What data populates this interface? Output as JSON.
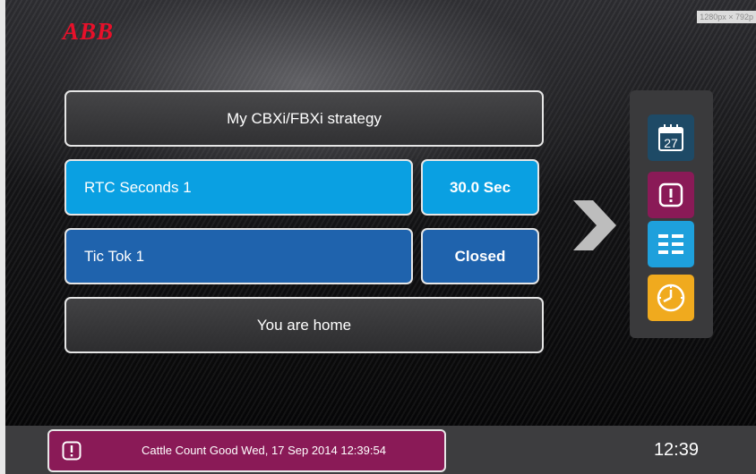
{
  "header": {
    "logo_text": "ABB",
    "resolution_badge": "1280px × 792p"
  },
  "tiles": {
    "strategy_title": "My CBXi/FBXi strategy",
    "rows": [
      {
        "label": "RTC Seconds 1",
        "value": "30.0 Sec",
        "color": "#0aa0e2"
      },
      {
        "label": "Tic Tok 1",
        "value": "Closed",
        "color": "#1f63ad"
      }
    ],
    "home_status": "You are home"
  },
  "sidebar": {
    "buttons": [
      {
        "icon": "calendar-icon",
        "calendar_day": "27",
        "color": "#1e4a66"
      },
      {
        "icon": "alarm-icon",
        "color": "#8a1a57"
      },
      {
        "icon": "list-icon",
        "color": "#1ea0dc"
      },
      {
        "icon": "clock-icon",
        "color": "#f0aa1e"
      }
    ]
  },
  "footer": {
    "alarm_text": "Cattle Count Good Wed, 17 Sep 2014 12:39:54",
    "time": "12:39"
  }
}
